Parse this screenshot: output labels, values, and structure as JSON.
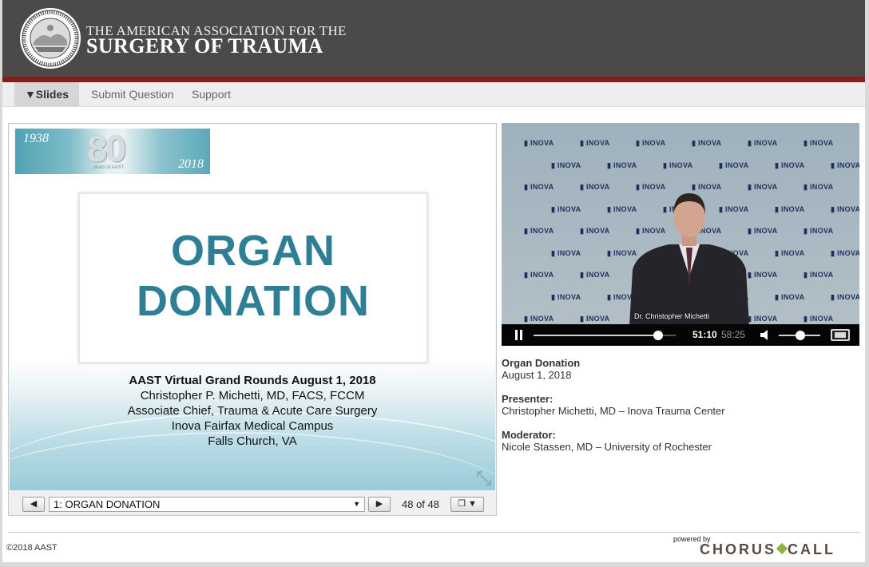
{
  "header": {
    "org_line1": "THE AMERICAN ASSOCIATION FOR THE",
    "org_line2": "SURGERY OF TRAUMA"
  },
  "nav": {
    "tabs": [
      {
        "label": "▼Slides",
        "active": true
      },
      {
        "label": "Submit Question",
        "active": false
      },
      {
        "label": "Support",
        "active": false
      }
    ]
  },
  "slide": {
    "anniversary": {
      "year_start": "1938",
      "number": "80",
      "subtitle": "years of AAST",
      "year_end": "2018"
    },
    "title_line1": "ORGAN",
    "title_line2": "DONATION",
    "info": [
      "AAST Virtual Grand Rounds August 1, 2018",
      "Christopher P. Michetti, MD, FACS, FCCM",
      "Associate Chief, Trauma & Acute Care Surgery",
      "Inova Fairfax Medical Campus",
      "Falls Church, VA"
    ]
  },
  "slide_controls": {
    "prev_label": "◀",
    "next_label": "▶",
    "selected_slide": "1: ORGAN DONATION",
    "counter": "48 of 48",
    "layout_label": "❐ ▼"
  },
  "video": {
    "backdrop_logo_text": "INOVA",
    "lower_third": "Dr. Christopher Michetti",
    "current_time": "51:10",
    "duration": "58:25",
    "progress": 0.875,
    "volume": 0.52
  },
  "event": {
    "title": "Organ Donation",
    "date": "August 1, 2018",
    "presenter_label": "Presenter:",
    "presenter": "Christopher Michetti, MD – Inova Trauma Center",
    "moderator_label": "Moderator:",
    "moderator": "Nicole Stassen, MD – University of Rochester"
  },
  "footer": {
    "copyright": "©2018 AAST",
    "powered_by": "powered by",
    "brand_left": "CHORUS",
    "brand_right": "CALL"
  },
  "colors": {
    "header_bg": "#4b4a49",
    "header_stripe": "#8e1a1a",
    "slide_title": "#2e7e96",
    "brand_green": "#8ab43c"
  }
}
